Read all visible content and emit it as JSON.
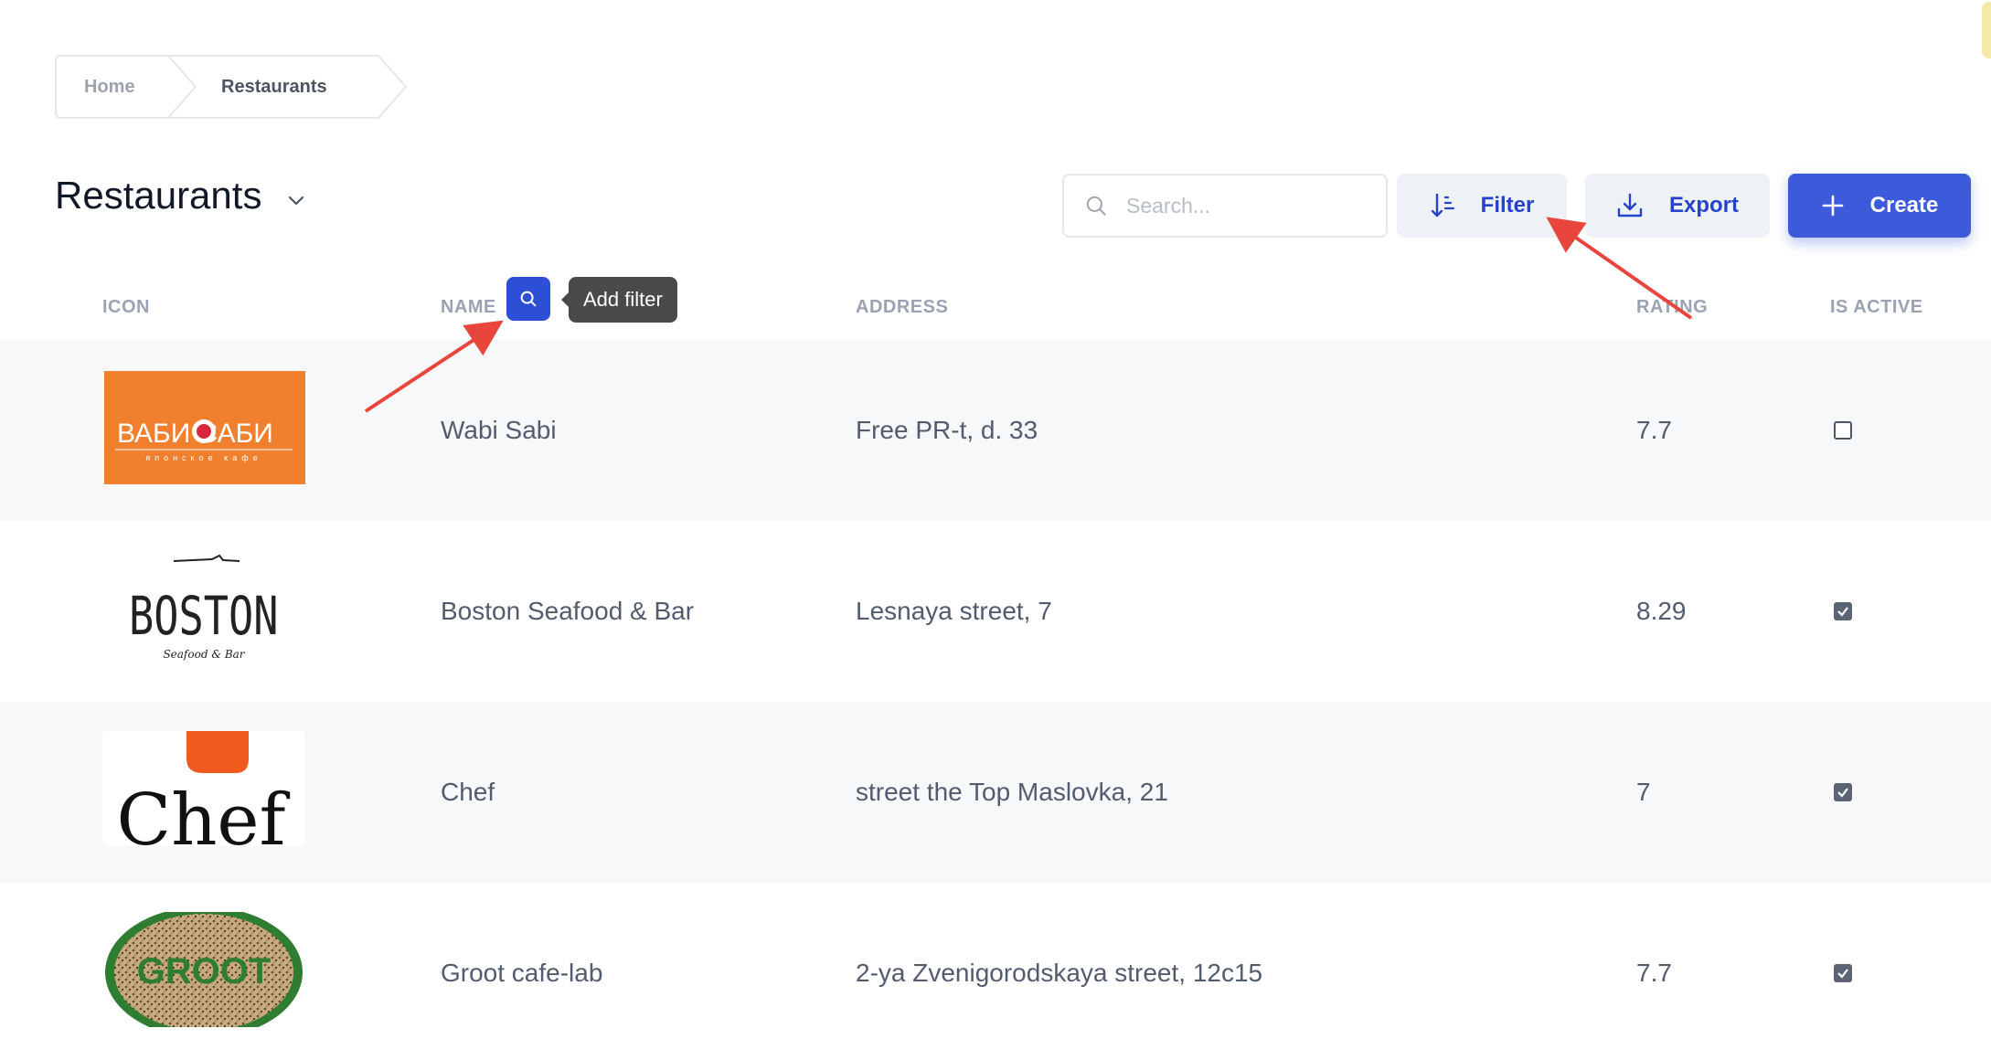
{
  "breadcrumb": {
    "home": "Home",
    "current": "Restaurants"
  },
  "page": {
    "title": "Restaurants"
  },
  "toolbar": {
    "search_placeholder": "Search...",
    "filter_label": "Filter",
    "export_label": "Export",
    "create_label": "Create"
  },
  "table": {
    "columns": {
      "icon": "ICON",
      "name": "NAME",
      "address": "ADDRESS",
      "rating": "RATING",
      "is_active": "IS ACTIVE"
    },
    "name_filter_tooltip": "Add filter",
    "rows": [
      {
        "logo": "ВАБИ САБИ",
        "logo_sub": "японское кафе",
        "name": "Wabi Sabi",
        "address": "Free PR-t, d. 33",
        "rating": "7.7",
        "is_active": false
      },
      {
        "logo": "BOSTON",
        "logo_sub": "Seafood & Bar",
        "name": "Boston Seafood & Bar",
        "address": "Lesnaya street, 7",
        "rating": "8.29",
        "is_active": true
      },
      {
        "logo": "Chef",
        "name": "Chef",
        "address": "street the Top Maslovka, 21",
        "rating": "7",
        "is_active": true
      },
      {
        "logo": "GROOT",
        "name": "Groot cafe-lab",
        "address": "2-ya Zvenigorodskaya street, 12c15",
        "rating": "7.7",
        "is_active": true
      }
    ]
  },
  "colors": {
    "primary": "#3b5bdb",
    "annotation": "#e8453c"
  }
}
